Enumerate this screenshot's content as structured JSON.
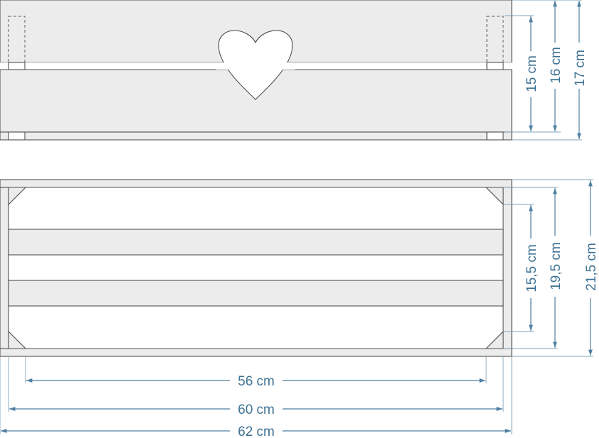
{
  "dimensions": {
    "front_view": {
      "height_inner": "15 cm",
      "height_mid": "16 cm",
      "height_outer": "17 cm"
    },
    "top_view": {
      "depth_inner": "15,5 cm",
      "depth_mid": "19,5 cm",
      "depth_outer": "21,5 cm",
      "length_inner": "56 cm",
      "length_mid": "60 cm",
      "length_outer": "62 cm"
    }
  },
  "colors": {
    "dimension_line": "#4e7fa0",
    "dimension_text": "#3f7294",
    "board_fill": "#ececec",
    "outline": "#505050"
  }
}
